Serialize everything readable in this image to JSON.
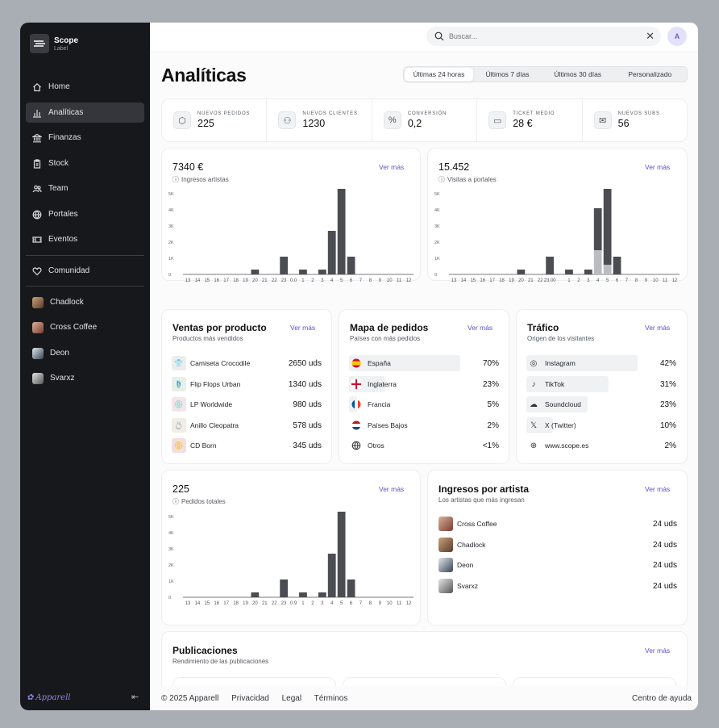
{
  "app": {
    "name": "Scope",
    "label": "Label"
  },
  "sidebar": {
    "items": [
      {
        "label": "Home",
        "icon": "home-icon"
      },
      {
        "label": "Analíticas",
        "icon": "chart-icon",
        "active": true
      },
      {
        "label": "Finanzas",
        "icon": "bank-icon"
      },
      {
        "label": "Stock",
        "icon": "clipboard-icon"
      },
      {
        "label": "Team",
        "icon": "users-icon"
      },
      {
        "label": "Portales",
        "icon": "globe-icon"
      },
      {
        "label": "Eventos",
        "icon": "ticket-icon"
      }
    ],
    "community": {
      "label": "Comunidad",
      "icon": "heart-icon"
    },
    "artists": [
      "Chadlock",
      "Cross Coffee",
      "Deon",
      "Svarxz"
    ],
    "footer_brand": "Apparell"
  },
  "topbar": {
    "search_placeholder": "Buscar...",
    "user_initial": "A"
  },
  "page": {
    "title": "Analíticas",
    "ranges": [
      "Últimas 24 horas",
      "Últimos 7 días",
      "Últimos 30 días",
      "Personalizado"
    ],
    "selected_range": "Últimas 24 horas"
  },
  "kpis": [
    {
      "label": "NUEVOS PEDIDOS",
      "value": "225",
      "icon": "box-icon"
    },
    {
      "label": "NUEVOS CLIENTES",
      "value": "1230",
      "icon": "users-icon"
    },
    {
      "label": "CONVERSIÓN",
      "value": "0,2",
      "icon": "percent-icon"
    },
    {
      "label": "TICKET MEDIO",
      "value": "28 €",
      "icon": "receipt-icon"
    },
    {
      "label": "NUEVOS SUBS",
      "value": "56",
      "icon": "mail-icon"
    }
  ],
  "see_more": "Ver más",
  "ingresos": {
    "value": "7340 €",
    "subtitle": "Ingresos artistas"
  },
  "visitas": {
    "value": "15.452",
    "subtitle": "Visitas a portales"
  },
  "pedidos": {
    "value": "225",
    "subtitle": "Pedidos totales"
  },
  "chart_data": [
    {
      "type": "bar",
      "title": "",
      "categories": [
        "13",
        "14",
        "15",
        "16",
        "17",
        "18",
        "19",
        "20",
        "21",
        "22",
        "23",
        "00",
        "1",
        "2",
        "3",
        "4",
        "5",
        "6",
        "7",
        "8",
        "9",
        "10",
        "11",
        "12"
      ],
      "tick_labels": [
        "13",
        "14",
        "15",
        "16",
        "17",
        "18",
        "19",
        "20",
        "21",
        "22",
        "23",
        "0.0",
        "1",
        "2",
        "3",
        "4",
        "5",
        "6",
        "7",
        "8",
        "9",
        "10",
        "11",
        "12"
      ],
      "values": [
        0,
        0,
        0,
        0,
        0,
        0,
        0,
        300,
        0,
        0,
        1100,
        0,
        300,
        0,
        300,
        2700,
        5300,
        1100,
        0,
        0,
        0,
        0,
        0,
        0
      ],
      "ylim": [
        0,
        5000
      ],
      "yticks": [
        "0",
        "1K",
        "2K",
        "3K",
        "4K",
        "5K"
      ]
    },
    {
      "type": "bar",
      "title": "",
      "categories": [
        "13",
        "14",
        "15",
        "16",
        "17",
        "18",
        "19",
        "20",
        "21",
        "22",
        "23",
        "00",
        "1",
        "2",
        "3",
        "4",
        "5",
        "6",
        "7",
        "8",
        "9",
        "10",
        "11",
        "12"
      ],
      "tick_labels": [
        "13",
        "14",
        "15",
        "16",
        "17",
        "18",
        "19",
        "20",
        "21",
        "22",
        "23.00",
        "",
        "1",
        "2",
        "3",
        "4",
        "5",
        "6",
        "7",
        "8",
        "9",
        "10",
        "11",
        "12"
      ],
      "series": [
        {
          "values": [
            0,
            0,
            0,
            0,
            0,
            0,
            0,
            300,
            0,
            0,
            1100,
            0,
            300,
            0,
            300,
            2600,
            4700,
            1100,
            0,
            0,
            0,
            0,
            0,
            0
          ]
        },
        {
          "values": [
            0,
            0,
            0,
            0,
            0,
            0,
            0,
            0,
            0,
            0,
            0,
            0,
            0,
            0,
            0,
            1500,
            600,
            0,
            0,
            0,
            0,
            0,
            0,
            0
          ]
        }
      ],
      "colors": [
        "#4b4d52",
        "#b9bcc1"
      ],
      "ylim": [
        0,
        5000
      ],
      "yticks": [
        "0",
        "1K",
        "2K",
        "3K",
        "4K",
        "5K"
      ]
    },
    {
      "type": "bar",
      "title": "",
      "categories": [
        "13",
        "14",
        "15",
        "16",
        "17",
        "18",
        "19",
        "20",
        "21",
        "22",
        "23",
        "00",
        "1",
        "2",
        "3",
        "4",
        "5",
        "6",
        "7",
        "8",
        "9",
        "10",
        "11",
        "12"
      ],
      "tick_labels": [
        "13",
        "14",
        "15",
        "16",
        "17",
        "18",
        "19",
        "20",
        "21",
        "22",
        "23",
        "0.9",
        "1",
        "2",
        "3",
        "4",
        "5",
        "6",
        "7",
        "8",
        "9",
        "10",
        "11",
        "12"
      ],
      "values": [
        0,
        0,
        0,
        0,
        0,
        0,
        0,
        300,
        0,
        0,
        1100,
        0,
        300,
        0,
        300,
        2700,
        5300,
        1100,
        0,
        0,
        0,
        0,
        0,
        0
      ],
      "ylim": [
        0,
        5000
      ],
      "yticks": [
        "0",
        "1K",
        "2K",
        "3K",
        "4K",
        "5K"
      ]
    }
  ],
  "ventas": {
    "title": "Ventas por producto",
    "subtitle": "Productos más vendidos",
    "items": [
      {
        "name": "Camiseta Crocodile",
        "value": "2650 uds"
      },
      {
        "name": "Flip Flops Urban",
        "value": "1340 uds"
      },
      {
        "name": "LP Worldwide",
        "value": "980 uds"
      },
      {
        "name": "Anillo Cleopatra",
        "value": "578 uds"
      },
      {
        "name": "CD Born",
        "value": "345 uds"
      }
    ]
  },
  "mapa": {
    "title": "Mapa de pedidos",
    "subtitle": "Países con más pedidos",
    "items": [
      {
        "name": "España",
        "value": "70%",
        "share": 0.7
      },
      {
        "name": "Inglaterra",
        "value": "23%",
        "share": 0.23
      },
      {
        "name": "Francia",
        "value": "5%",
        "share": 0.05
      },
      {
        "name": "Países Bajos",
        "value": "2%",
        "share": 0.02
      },
      {
        "name": "Otros",
        "value": "<1%",
        "share": 0.01
      }
    ]
  },
  "trafico": {
    "title": "Tráfico",
    "subtitle": "Origen de los visitantes",
    "items": [
      {
        "name": "Instagram",
        "value": "42%",
        "share": 0.42
      },
      {
        "name": "TikTok",
        "value": "31%",
        "share": 0.31
      },
      {
        "name": "Soundcloud",
        "value": "23%",
        "share": 0.23
      },
      {
        "name": "X (Twitter)",
        "value": "10%",
        "share": 0.1
      },
      {
        "name": "www.scope.es",
        "value": "2%",
        "share": 0.02
      }
    ]
  },
  "ingresos_artista": {
    "title": "Ingresos por artista",
    "subtitle": "Los artistas que más ingresan",
    "items": [
      {
        "name": "Cross Coffee",
        "value": "24 uds"
      },
      {
        "name": "Chadlock",
        "value": "24 uds"
      },
      {
        "name": "Deon",
        "value": "24 uds"
      },
      {
        "name": "Svarxz",
        "value": "24 uds"
      }
    ]
  },
  "publicaciones": {
    "title": "Publicaciones",
    "subtitle": "Rendimiento de las publicaciones"
  },
  "footer": {
    "copyright": "© 2025 Apparell",
    "links": [
      "Privacidad",
      "Legal",
      "Términos"
    ],
    "help": "Centro de ayuda"
  },
  "colors": {
    "accent": "#5b52c6",
    "bar": "#4b4d52",
    "bar_light": "#b9bcc1",
    "sidebar": "#17181c"
  }
}
